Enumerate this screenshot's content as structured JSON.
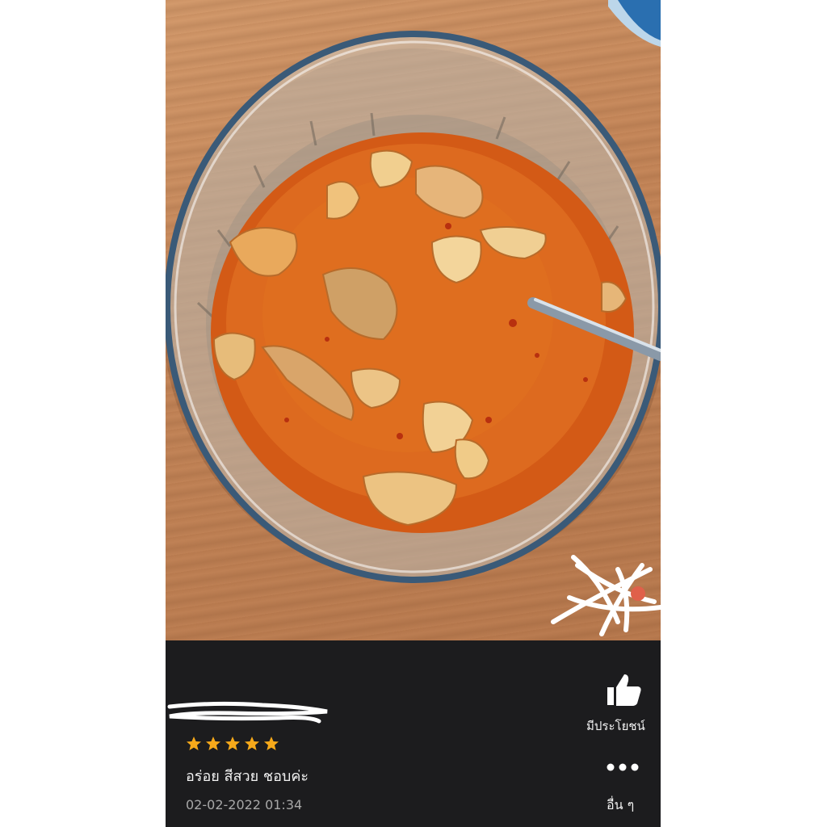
{
  "review": {
    "rating": 5,
    "rating_max": 5,
    "comment": "อร่อย สีสวย ชอบค่ะ",
    "timestamp": "02-02-2022 01:34",
    "helpful_label": "มีประโยชน์",
    "more_label": "อื่น ๆ"
  },
  "icons": {
    "helpful": "thumbs-up-icon",
    "more": "more-dots-icon",
    "star": "star-icon"
  },
  "colors": {
    "panel_bg": "#1c1c1e",
    "star": "#f6a91a",
    "text": "#f2f2f2",
    "subtext": "#a8a8a8"
  }
}
